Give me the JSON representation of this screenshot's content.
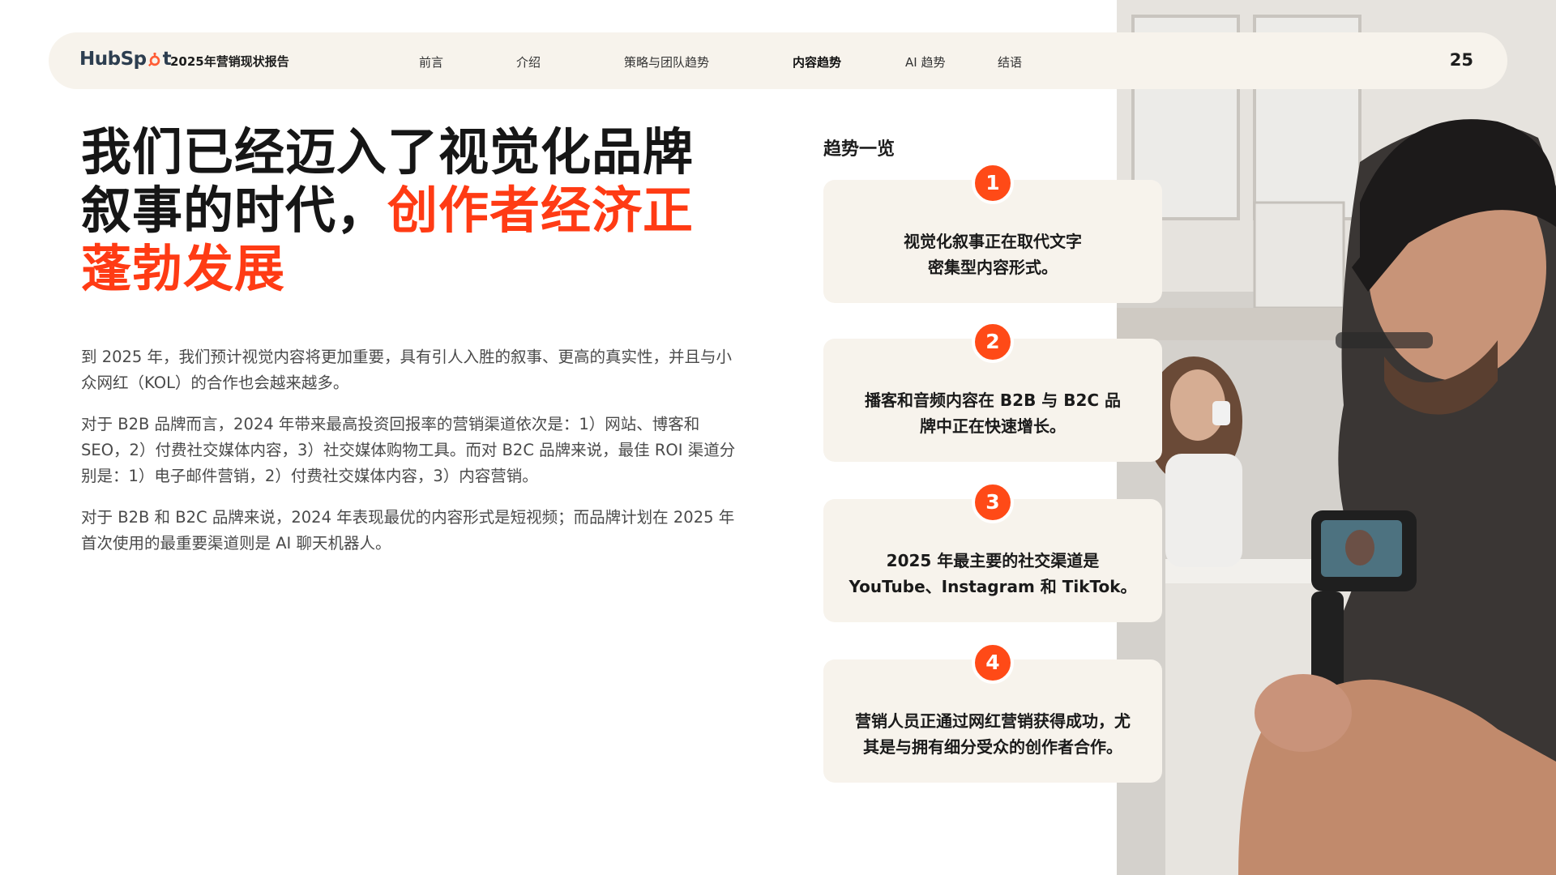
{
  "brand": {
    "logo_text_left": "HubSp",
    "logo_text_right": "t",
    "accent_color": "#ff4a17"
  },
  "nav": {
    "report_title": "2025年营销现状报告",
    "items": [
      {
        "label": "前言",
        "active": false
      },
      {
        "label": "介绍",
        "active": false
      },
      {
        "label": "策略与团队趋势",
        "active": false
      },
      {
        "label": "内容趋势",
        "active": true
      },
      {
        "label": "AI 趋势",
        "active": false
      },
      {
        "label": "结语",
        "active": false
      }
    ],
    "page_number": "25"
  },
  "headline": {
    "line1": "我们已经迈入了视觉化品牌",
    "line2_plain": "叙事的时代，",
    "line2_accent": "创作者经济正",
    "line3_accent": "蓬勃发展"
  },
  "body": {
    "paragraphs": [
      "到 2025 年，我们预计视觉内容将更加重要，具有引人入胜的叙事、更高的真实性，并且与小众网红（KOL）的合作也会越来越多。",
      "对于 B2B 品牌而言，2024 年带来最高投资回报率的营销渠道依次是：1）网站、博客和 SEO，2）付费社交媒体内容，3）社交媒体购物工具。而对 B2C 品牌来说，最佳 ROI 渠道分别是：1）电子邮件营销，2）付费社交媒体内容，3）内容营销。",
      "对于 B2B 和 B2C 品牌来说，2024 年表现最优的内容形式是短视频；而品牌计划在 2025 年首次使用的最重要渠道则是 AI 聊天机器人。"
    ]
  },
  "trends": {
    "heading": "趋势一览",
    "items": [
      {
        "number": "1",
        "text": "视觉化叙事正在取代文字\n密集型内容形式。"
      },
      {
        "number": "2",
        "text": "播客和音频内容在 B2B 与 B2C 品\n牌中正在快速增长。"
      },
      {
        "number": "3",
        "text": "2025 年最主要的社交渠道是\nYouTube、Instagram 和 TikTok。"
      },
      {
        "number": "4",
        "text": "营销人员正通过网红营销获得成功，尤\n其是与拥有细分受众的创作者合作。"
      }
    ]
  }
}
